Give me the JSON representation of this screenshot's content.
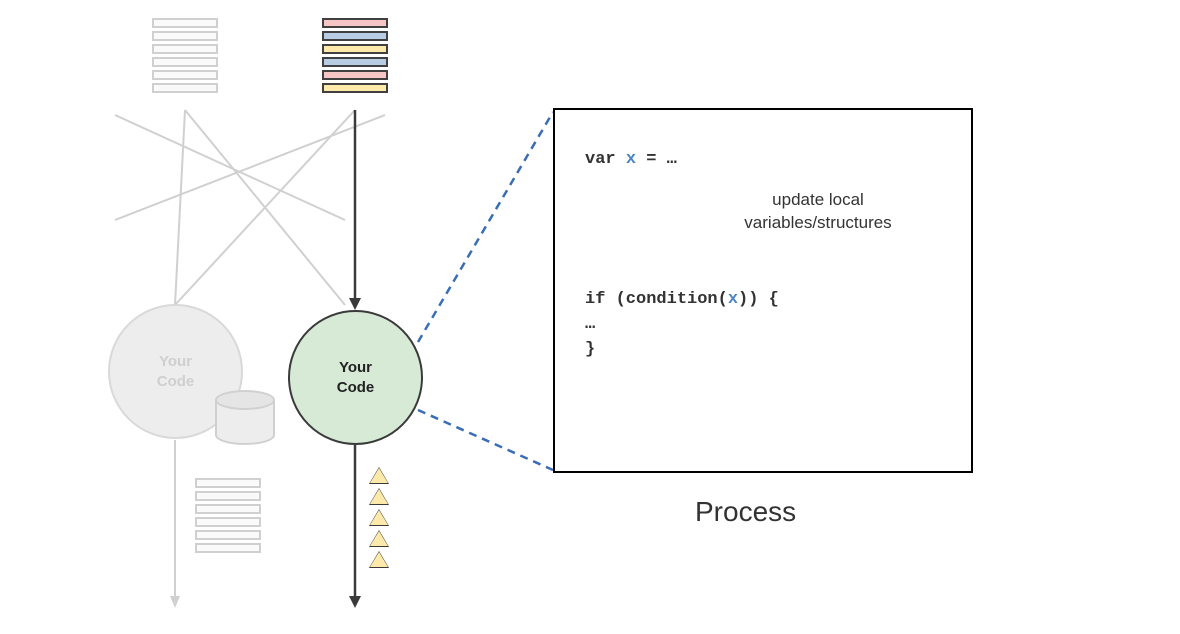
{
  "faded_circle_label": "Your\nCode",
  "active_circle_label": "Your\nCode",
  "code": {
    "line1_pre": "var ",
    "line1_var": "x",
    "line1_post": " = …",
    "annotation_l1": "update local",
    "annotation_l2": "variables/structures",
    "line2_pre": "if (condition(",
    "line2_var": "x",
    "line2_post": ")) {",
    "line3": "  …",
    "line4": "}"
  },
  "process_label": "Process",
  "colored_stack_colors": [
    "pink",
    "blue",
    "yellow",
    "blue",
    "pink",
    "yellow"
  ]
}
